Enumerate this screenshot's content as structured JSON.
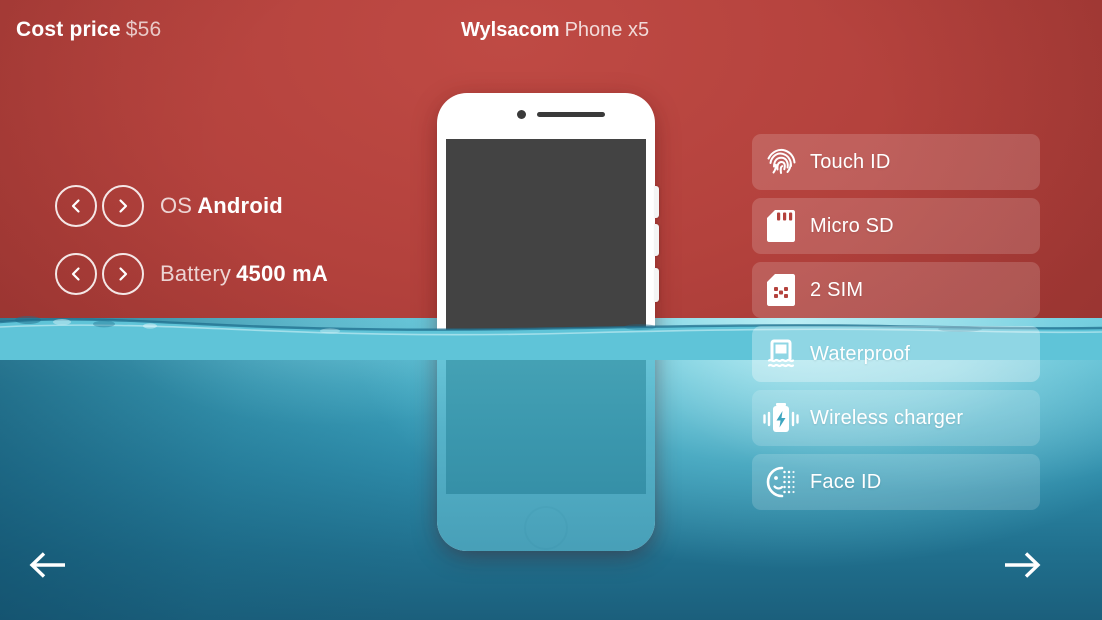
{
  "header": {
    "cost_label": "Cost price",
    "cost_value": "$56",
    "brand": "Wylsacom",
    "model": "Phone x5"
  },
  "specs": [
    {
      "key": "OS",
      "value": "Android",
      "prev_icon": "chevron-left-icon",
      "next_icon": "chevron-right-icon"
    },
    {
      "key": "Battery",
      "value": "4500 mA",
      "prev_icon": "chevron-left-icon",
      "next_icon": "chevron-right-icon"
    }
  ],
  "features": [
    {
      "label": "Touch ID",
      "icon": "fingerprint-icon",
      "selected": false
    },
    {
      "label": "Micro SD",
      "icon": "sd-card-icon",
      "selected": false
    },
    {
      "label": "2 SIM",
      "icon": "sim-card-icon",
      "selected": false
    },
    {
      "label": "Waterproof",
      "icon": "waterproof-icon",
      "selected": true
    },
    {
      "label": "Wireless charger",
      "icon": "wireless-charger-icon",
      "selected": false
    },
    {
      "label": "Face ID",
      "icon": "face-id-icon",
      "selected": false
    }
  ],
  "nav": {
    "prev_icon": "arrow-left-icon",
    "next_icon": "arrow-right-icon"
  },
  "colors": {
    "air_red": "#b4423d",
    "water_top": "#5fc4d8",
    "water_bottom": "#1b5f7c",
    "phone_body": "#ffffff",
    "phone_screen": "#434343",
    "text_white": "#ffffff"
  }
}
